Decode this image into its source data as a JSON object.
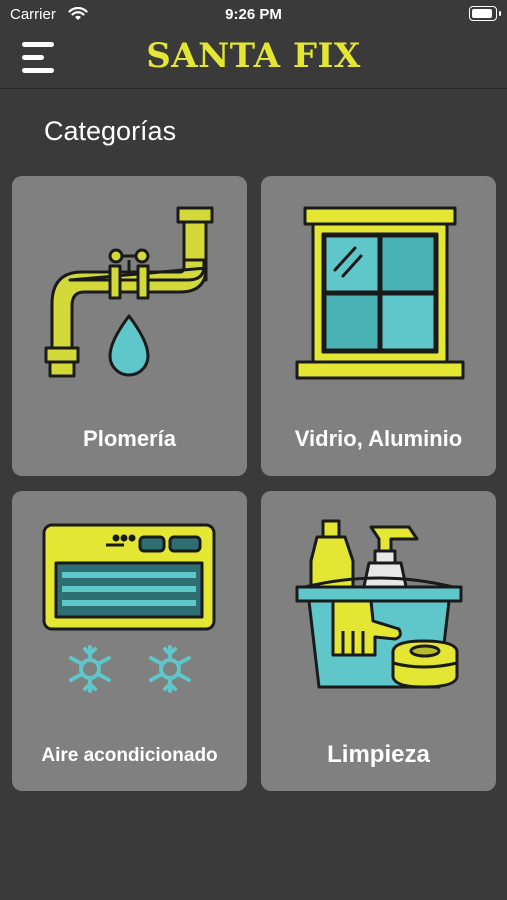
{
  "status_bar": {
    "carrier": "Carrier",
    "time": "9:26 PM"
  },
  "header": {
    "title": "SANTA FIX",
    "menu_icon": "hamburger-menu-icon"
  },
  "main": {
    "section_title": "Categorías",
    "categories": [
      {
        "label": "Plomería",
        "icon": "pipe-faucet-icon"
      },
      {
        "label": "Vidrio, Aluminio",
        "icon": "window-icon"
      },
      {
        "label": "Aire acondicionado",
        "icon": "air-conditioner-icon"
      },
      {
        "label": "Limpieza",
        "icon": "cleaning-supplies-icon"
      }
    ]
  },
  "colors": {
    "background": "#3a3a3a",
    "card": "#808080",
    "title_accent": "#e3e633",
    "icon_yellow": "#d4d93a",
    "icon_teal": "#5fc7c9",
    "icon_outline": "#1a1a1a"
  }
}
